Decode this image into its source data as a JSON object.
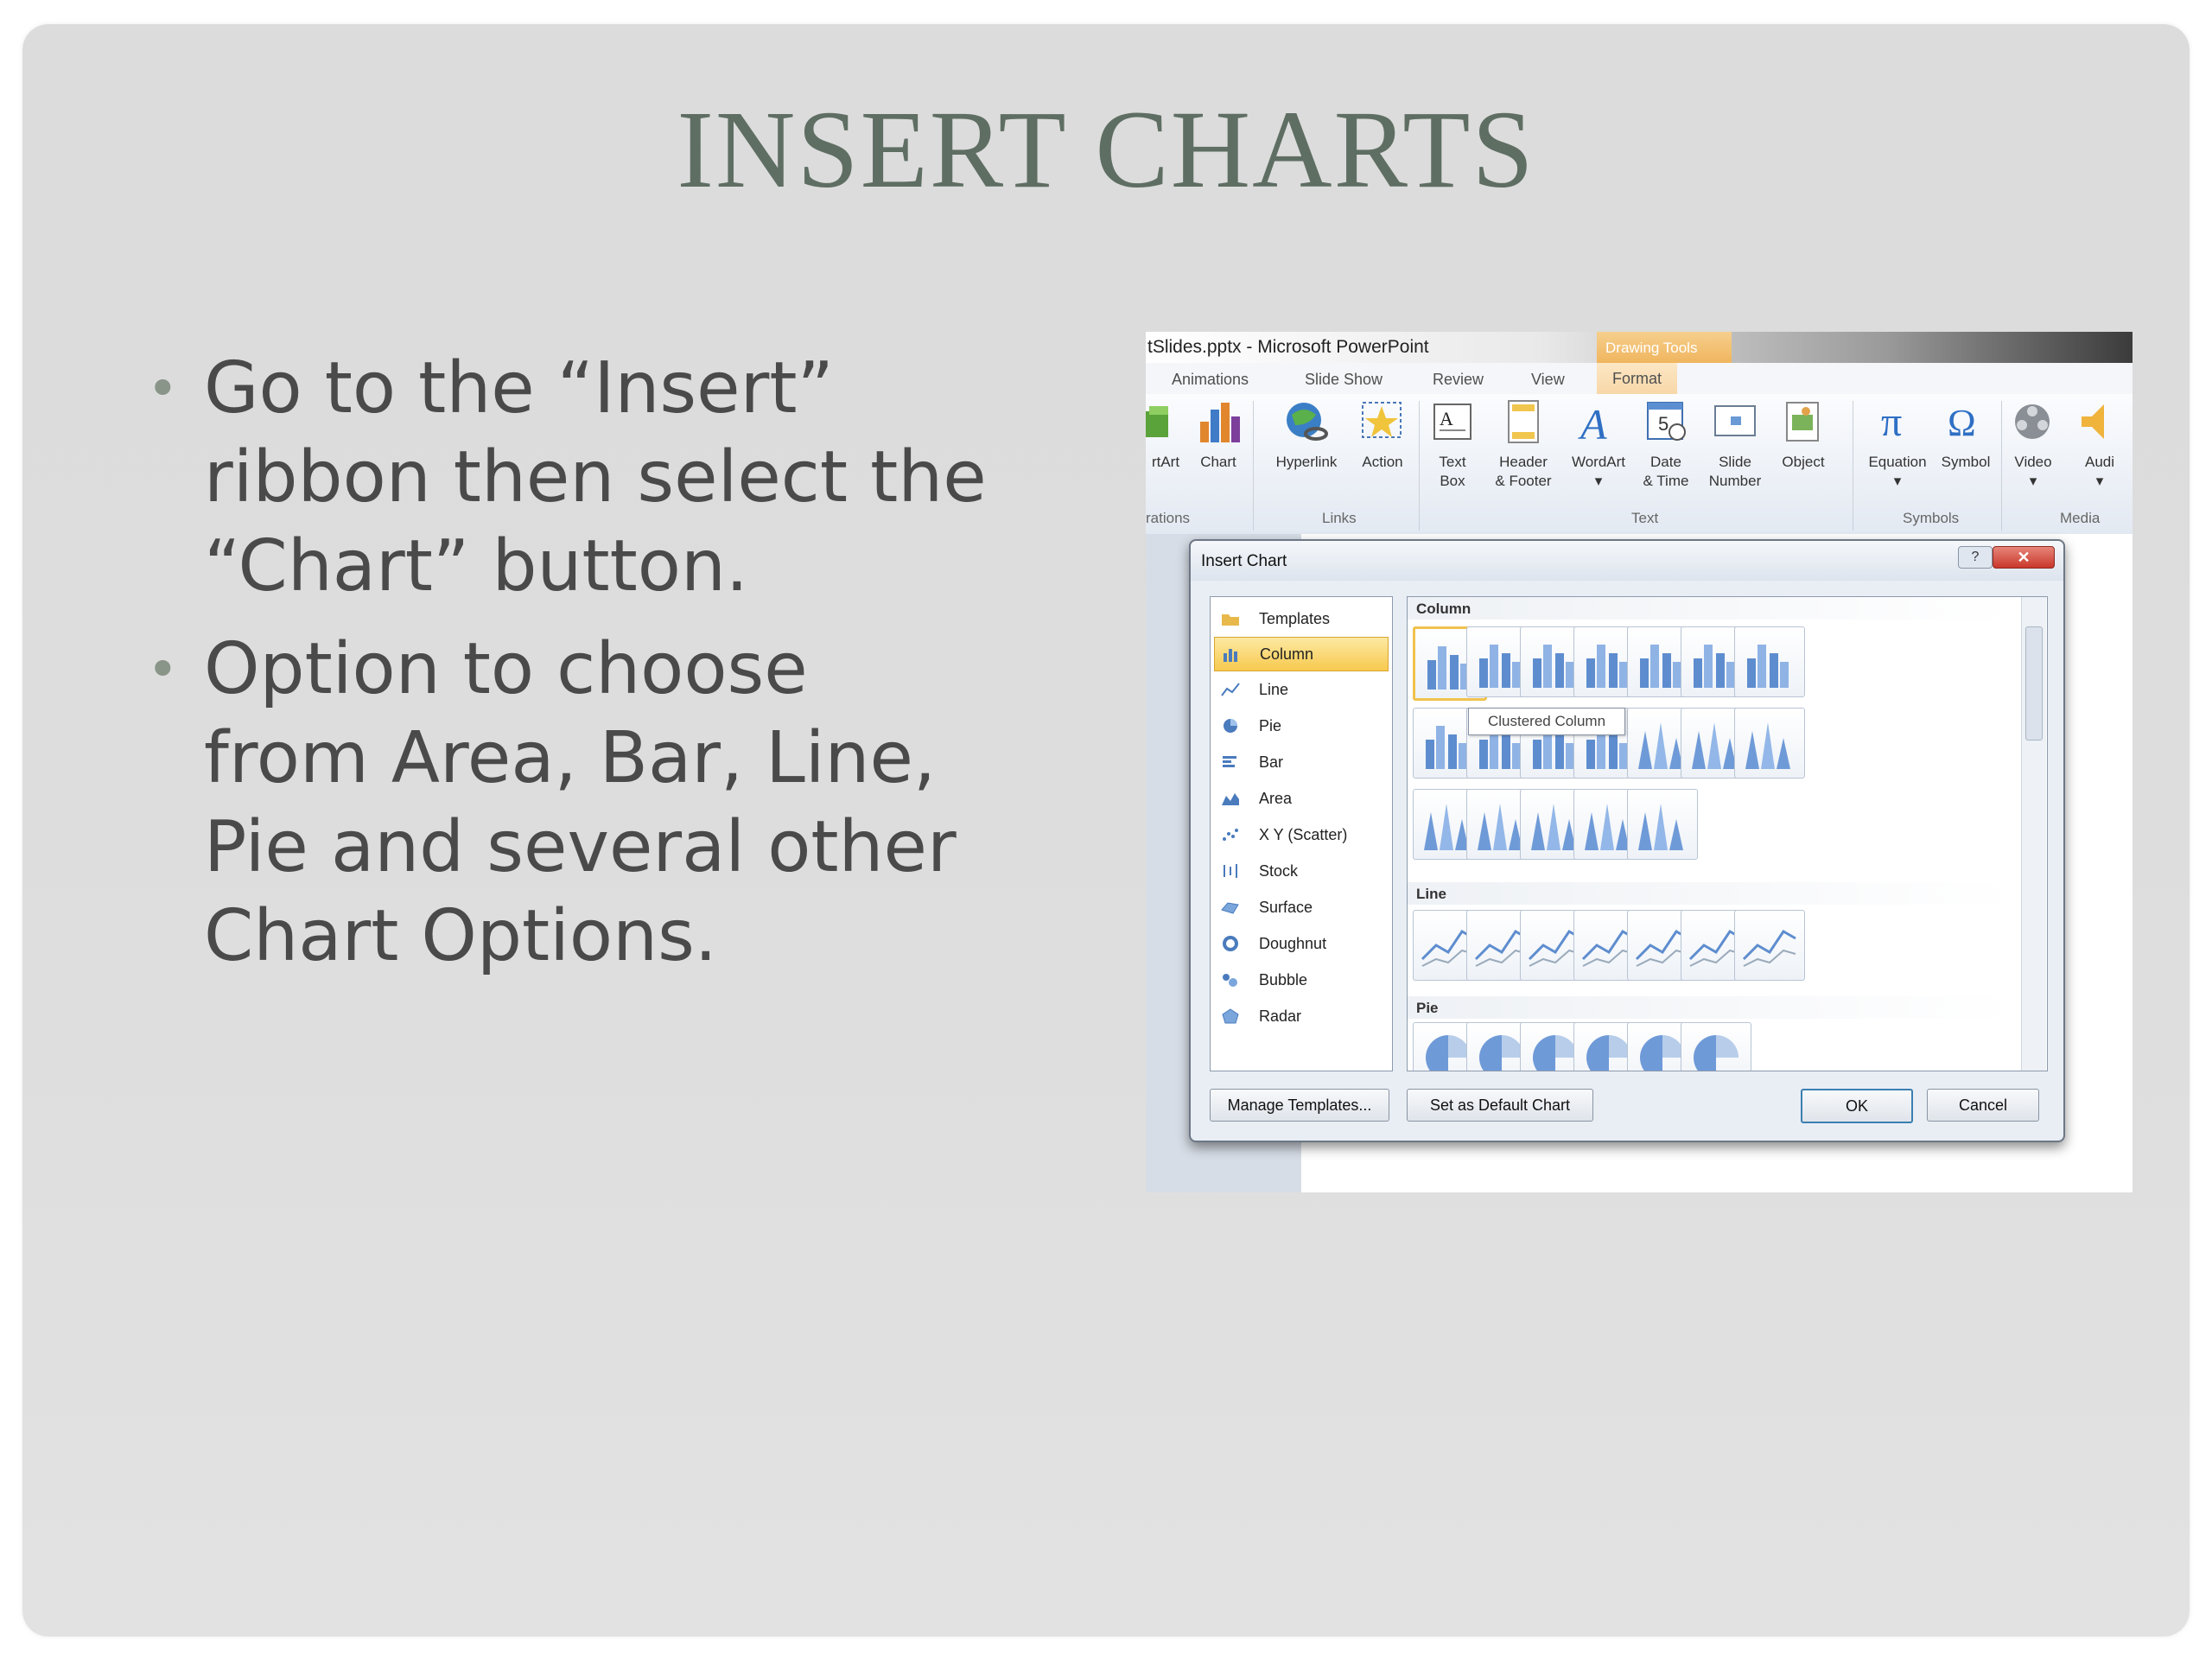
{
  "slide": {
    "title": "INSERT CHARTS",
    "bullets": [
      "Go to the “Insert” ribbon then select the “Chart” button.",
      "Option to choose from Area, Bar, Line, Pie and several other Chart Options."
    ],
    "accent_color": "#5f6e63",
    "text_color": "#4a4a4a"
  },
  "screenshot": {
    "window_title": "tSlides.pptx - Microsoft PowerPoint",
    "context_tab_group": "Drawing Tools",
    "tabs": [
      "Animations",
      "Slide Show",
      "Review",
      "View",
      "Format"
    ],
    "ribbon": {
      "buttons": [
        {
          "label": "rtArt",
          "icon": "smartart-icon"
        },
        {
          "label": "Chart",
          "icon": "chart-icon"
        },
        {
          "label": "Hyperlink",
          "icon": "hyperlink-icon"
        },
        {
          "label": "Action",
          "icon": "action-icon"
        },
        {
          "label": "Text\nBox",
          "icon": "textbox-icon"
        },
        {
          "label": "Header\n& Footer",
          "icon": "header-footer-icon"
        },
        {
          "label": "WordArt\n▾",
          "icon": "wordart-icon"
        },
        {
          "label": "Date\n& Time",
          "icon": "date-time-icon"
        },
        {
          "label": "Slide\nNumber",
          "icon": "slide-number-icon"
        },
        {
          "label": "Object",
          "icon": "object-icon"
        },
        {
          "label": "Equation\n▾",
          "icon": "equation-icon"
        },
        {
          "label": "Symbol",
          "icon": "symbol-icon"
        },
        {
          "label": "Video\n▾",
          "icon": "video-icon"
        },
        {
          "label": "Audi\n▾",
          "icon": "audio-icon"
        }
      ],
      "groups": [
        "rations",
        "Links",
        "Text",
        "Symbols",
        "Media"
      ]
    },
    "dialog": {
      "title": "Insert Chart",
      "help": "?",
      "close": "✕",
      "categories": [
        "Templates",
        "Column",
        "Line",
        "Pie",
        "Bar",
        "Area",
        "X Y (Scatter)",
        "Stock",
        "Surface",
        "Doughnut",
        "Bubble",
        "Radar"
      ],
      "selected_category": "Column",
      "sections": [
        "Column",
        "Line",
        "Pie"
      ],
      "tooltip": "Clustered Column",
      "buttons": {
        "manage": "Manage Templates...",
        "set_default": "Set as Default Chart",
        "ok": "OK",
        "cancel": "Cancel"
      }
    }
  }
}
